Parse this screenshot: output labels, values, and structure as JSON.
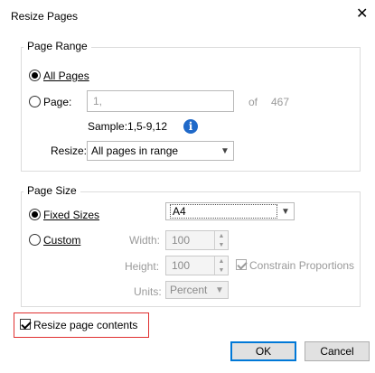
{
  "dialog": {
    "title": "Resize Pages",
    "close_glyph": "✕"
  },
  "page_range": {
    "legend": "Page Range",
    "all_pages_label": "All Pages",
    "page_label": "Page:",
    "page_input_value": "1,",
    "of_label": "of",
    "total_pages": "467",
    "sample_text": "Sample:1,5-9,12",
    "resize_label": "Resize:",
    "resize_value": "All pages in range",
    "selected": "all_pages"
  },
  "page_size": {
    "legend": "Page Size",
    "fixed_sizes_label": "Fixed Sizes",
    "fixed_sizes_value": "A4",
    "custom_label": "Custom",
    "width_label": "Width:",
    "width_value": "100",
    "height_label": "Height:",
    "height_value": "100",
    "constrain_label": "Constrain Proportions",
    "units_label": "Units:",
    "units_value": "Percent",
    "selected": "fixed_sizes"
  },
  "resize_contents": {
    "label": "Resize page contents",
    "checked": true
  },
  "buttons": {
    "ok": "OK",
    "cancel": "Cancel"
  },
  "colors": {
    "info_icon": "#1f69c9",
    "highlight_border": "#e03030",
    "default_button_border": "#0078d7"
  }
}
